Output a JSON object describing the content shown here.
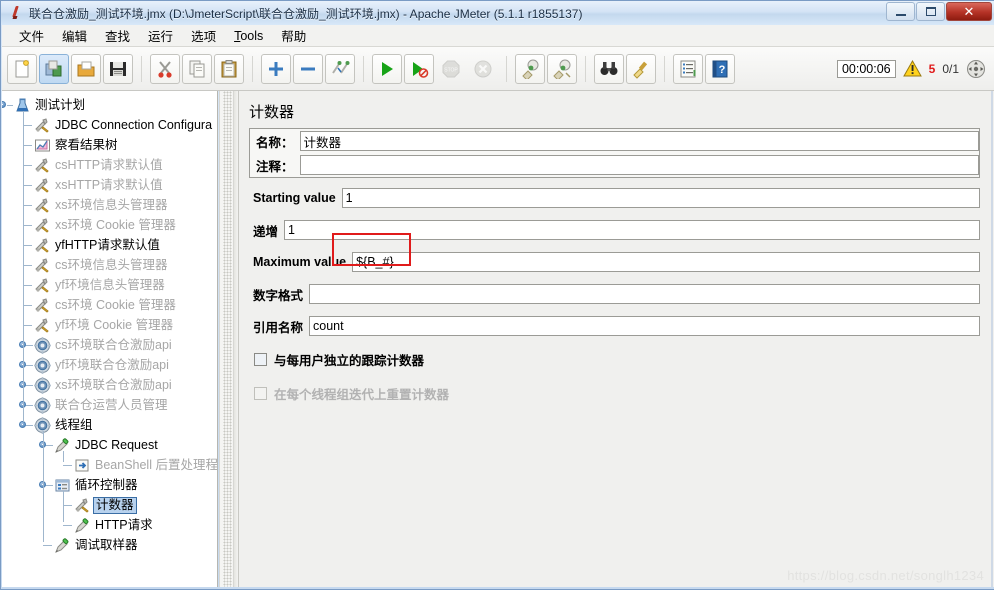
{
  "window": {
    "title": "联合仓激励_测试环境.jmx (D:\\JmeterScript\\联合仓激励_测试环境.jmx) - Apache JMeter (5.1.1 r1855137)",
    "app_icon": "jmeter-feather-icon",
    "minimize_label": "",
    "maximize_label": "",
    "close_label": "✕"
  },
  "menubar": {
    "items": [
      {
        "label": "文件",
        "name": "menu-file"
      },
      {
        "label": "编辑",
        "name": "menu-edit"
      },
      {
        "label": "查找",
        "name": "menu-search"
      },
      {
        "label": "运行",
        "name": "menu-run"
      },
      {
        "label": "选项",
        "name": "menu-options"
      },
      {
        "label": "Tools",
        "name": "menu-tools",
        "mnemonic": "T"
      },
      {
        "label": "帮助",
        "name": "menu-help"
      }
    ]
  },
  "toolbar": {
    "buttons": [
      {
        "name": "new-button",
        "icon": "new-document-icon",
        "state": "framed"
      },
      {
        "name": "templates-button",
        "icon": "templates-icon",
        "state": "selected"
      },
      {
        "name": "open-button",
        "icon": "open-folder-icon",
        "state": "framed"
      },
      {
        "name": "save-button",
        "icon": "save-disk-icon",
        "state": "framed"
      },
      {
        "name": "cut-button",
        "icon": "scissors-icon",
        "state": "framed"
      },
      {
        "name": "copy-button",
        "icon": "copy-icon",
        "state": "framed"
      },
      {
        "name": "paste-button",
        "icon": "clipboard-paste-icon",
        "state": "framed"
      },
      {
        "name": "expand-all-button",
        "icon": "plus-icon",
        "state": "framed"
      },
      {
        "name": "collapse-all-button",
        "icon": "minus-icon",
        "state": "framed"
      },
      {
        "name": "toggle-button",
        "icon": "toggle-pins-icon",
        "state": "framed"
      },
      {
        "name": "start-button",
        "icon": "play-green-icon",
        "state": "framed"
      },
      {
        "name": "start-no-pauses-button",
        "icon": "play-no-pause-icon",
        "state": "framed"
      },
      {
        "name": "stop-button",
        "icon": "stop-sign-icon",
        "state": "disabled"
      },
      {
        "name": "shutdown-button",
        "icon": "shutdown-x-icon",
        "state": "disabled"
      },
      {
        "name": "clear-button",
        "icon": "clear-broom-icon",
        "state": "framed"
      },
      {
        "name": "clear-all-button",
        "icon": "clear-all-broom-icon",
        "state": "framed"
      },
      {
        "name": "search-button",
        "icon": "binoculars-icon",
        "state": "framed"
      },
      {
        "name": "reset-search-button",
        "icon": "broom-reset-icon",
        "state": "framed"
      },
      {
        "name": "function-helper-button",
        "icon": "function-list-icon",
        "state": "framed"
      },
      {
        "name": "help-button",
        "icon": "help-book-icon",
        "state": "framed"
      }
    ],
    "status": {
      "elapsed_time": "00:00:06",
      "warning_icon": "warning-triangle-icon",
      "error_count": "5",
      "threads": "0/1",
      "expand_icon": "expand-arrows-icon"
    }
  },
  "tree": {
    "nodes": [
      {
        "label": "测试计划",
        "icon": "test-plan-icon",
        "depth": 0,
        "disabled": false,
        "selected": false,
        "expander": "expanded",
        "name": "tree-node-test-plan"
      },
      {
        "label": "JDBC Connection Configura",
        "icon": "config-element-icon",
        "depth": 1,
        "disabled": false,
        "selected": false,
        "expander": "none",
        "name": "tree-node-jdbc-connection-configuration"
      },
      {
        "label": "察看结果树",
        "icon": "view-results-tree-icon",
        "depth": 1,
        "disabled": false,
        "selected": false,
        "expander": "none",
        "name": "tree-node-view-results-tree"
      },
      {
        "label": "csHTTP请求默认值",
        "icon": "config-element-icon",
        "depth": 1,
        "disabled": true,
        "selected": false,
        "expander": "none",
        "name": "tree-node-cs-http-request-defaults"
      },
      {
        "label": "xsHTTP请求默认值",
        "icon": "config-element-icon",
        "depth": 1,
        "disabled": true,
        "selected": false,
        "expander": "none",
        "name": "tree-node-xs-http-request-defaults"
      },
      {
        "label": "xs环境信息头管理器",
        "icon": "config-element-icon",
        "depth": 1,
        "disabled": true,
        "selected": false,
        "expander": "none",
        "name": "tree-node-xs-header-manager"
      },
      {
        "label": "xs环境 Cookie 管理器",
        "icon": "config-element-icon",
        "depth": 1,
        "disabled": true,
        "selected": false,
        "expander": "none",
        "name": "tree-node-xs-cookie-manager"
      },
      {
        "label": "yfHTTP请求默认值",
        "icon": "config-element-icon",
        "depth": 1,
        "disabled": false,
        "selected": false,
        "expander": "none",
        "name": "tree-node-yf-http-request-defaults"
      },
      {
        "label": "cs环境信息头管理器",
        "icon": "config-element-icon",
        "depth": 1,
        "disabled": true,
        "selected": false,
        "expander": "none",
        "name": "tree-node-cs-header-manager"
      },
      {
        "label": "yf环境信息头管理器",
        "icon": "config-element-icon",
        "depth": 1,
        "disabled": true,
        "selected": false,
        "expander": "none",
        "name": "tree-node-yf-header-manager"
      },
      {
        "label": "cs环境 Cookie 管理器",
        "icon": "config-element-icon",
        "depth": 1,
        "disabled": true,
        "selected": false,
        "expander": "none",
        "name": "tree-node-cs-cookie-manager"
      },
      {
        "label": "yf环境 Cookie 管理器",
        "icon": "config-element-icon",
        "depth": 1,
        "disabled": true,
        "selected": false,
        "expander": "none",
        "name": "tree-node-yf-cookie-manager"
      },
      {
        "label": "cs环境联合仓激励api",
        "icon": "thread-group-icon",
        "depth": 1,
        "disabled": true,
        "selected": false,
        "expander": "collapsed",
        "name": "tree-node-cs-thread-group"
      },
      {
        "label": "yf环境联合仓激励api",
        "icon": "thread-group-icon",
        "depth": 1,
        "disabled": true,
        "selected": false,
        "expander": "collapsed",
        "name": "tree-node-yf-thread-group"
      },
      {
        "label": "xs环境联合仓激励api",
        "icon": "thread-group-icon",
        "depth": 1,
        "disabled": true,
        "selected": false,
        "expander": "collapsed",
        "name": "tree-node-xs-thread-group"
      },
      {
        "label": "联合仓运营人员管理",
        "icon": "thread-group-icon",
        "depth": 1,
        "disabled": true,
        "selected": false,
        "expander": "collapsed",
        "name": "tree-node-operations-thread-group"
      },
      {
        "label": "线程组",
        "icon": "thread-group-icon",
        "depth": 1,
        "disabled": false,
        "selected": false,
        "expander": "expanded",
        "name": "tree-node-thread-group"
      },
      {
        "label": "JDBC Request",
        "icon": "sampler-icon",
        "depth": 2,
        "disabled": false,
        "selected": false,
        "expander": "expanded",
        "name": "tree-node-jdbc-request"
      },
      {
        "label": "BeanShell 后置处理程",
        "icon": "post-processor-icon",
        "depth": 3,
        "disabled": true,
        "selected": false,
        "expander": "none",
        "name": "tree-node-beanshell-post-processor"
      },
      {
        "label": "循环控制器",
        "icon": "loop-controller-icon",
        "depth": 2,
        "disabled": false,
        "selected": false,
        "expander": "expanded",
        "name": "tree-node-loop-controller"
      },
      {
        "label": "计数器",
        "icon": "config-element-icon",
        "depth": 3,
        "disabled": false,
        "selected": true,
        "expander": "none",
        "name": "tree-node-counter"
      },
      {
        "label": "HTTP请求",
        "icon": "sampler-icon",
        "depth": 3,
        "disabled": false,
        "selected": false,
        "expander": "none",
        "name": "tree-node-http-request"
      },
      {
        "label": "调试取样器",
        "icon": "sampler-icon",
        "depth": 2,
        "disabled": false,
        "selected": false,
        "expander": "none",
        "name": "tree-node-debug-sampler"
      }
    ]
  },
  "panel": {
    "title": "计数器",
    "fields": {
      "name_label": "名称：",
      "name_value": "计数器",
      "comment_label": "注释：",
      "comment_value": "",
      "starting_value_label": "Starting value",
      "starting_value": "1",
      "increment_label": "递增",
      "increment_value": "1",
      "maximum_value_label": "Maximum value",
      "maximum_value": "${B_#}",
      "number_format_label": "数字格式",
      "number_format_value": "",
      "reference_name_label": "引用名称",
      "reference_name_value": "count"
    },
    "checkboxes": [
      {
        "label": "与每用户独立的跟踪计数器",
        "checked": false,
        "enabled": true,
        "name": "checkbox-per-user"
      },
      {
        "label": "在每个线程组迭代上重置计数器",
        "checked": false,
        "enabled": false,
        "name": "checkbox-reset-on-each-iteration"
      }
    ],
    "annotation": {
      "name": "red-highlight-box",
      "color": "#e01b1b"
    }
  },
  "watermark": {
    "text": "https://blog.csdn.net/songlh1234"
  }
}
